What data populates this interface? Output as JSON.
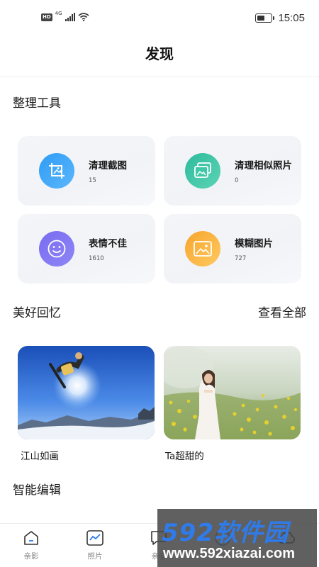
{
  "status_bar": {
    "hd_badge": "HD",
    "network": "4G",
    "time": "15:05",
    "battery_level": 0.6
  },
  "header": {
    "title": "发现"
  },
  "tools_section": {
    "title": "整理工具",
    "cards": [
      {
        "name": "清理截图",
        "count": "15",
        "icon": "crop-image-icon",
        "color_from": "#2f9cf5",
        "color_to": "#5bb6fb"
      },
      {
        "name": "清理相似照片",
        "count": "0",
        "icon": "similar-photos-icon",
        "color_from": "#2dbb9c",
        "color_to": "#5cd4b5"
      },
      {
        "name": "表情不佳",
        "count": "1610",
        "icon": "smiley-face-icon",
        "color_from": "#7a6cf0",
        "color_to": "#8e86f6"
      },
      {
        "name": "模糊图片",
        "count": "727",
        "icon": "blurry-image-icon",
        "color_from": "#f7a52e",
        "color_to": "#ffc95f"
      }
    ]
  },
  "memories_section": {
    "title": "美好回忆",
    "view_all": "查看全部",
    "items": [
      {
        "caption": "江山如画",
        "image": "snowboarder-jump-photo"
      },
      {
        "caption": "Ta超甜的",
        "image": "woman-in-flower-field-photo"
      }
    ]
  },
  "smart_edit_section": {
    "title": "智能编辑"
  },
  "bottom_nav": {
    "items": [
      {
        "label": "亲影",
        "icon": "home-icon"
      },
      {
        "label": "照片",
        "icon": "photos-icon"
      },
      {
        "label": "亲@",
        "icon": "chat-icon"
      },
      {
        "label": "",
        "icon": "discover-icon"
      },
      {
        "label": "",
        "icon": "cloud-icon"
      }
    ]
  },
  "watermark": {
    "brand": "592软件园",
    "url": "www.592xiazai.com"
  },
  "colors": {
    "accent": "#2f7bea",
    "text": "#1a1a1a",
    "muted": "#888888"
  }
}
